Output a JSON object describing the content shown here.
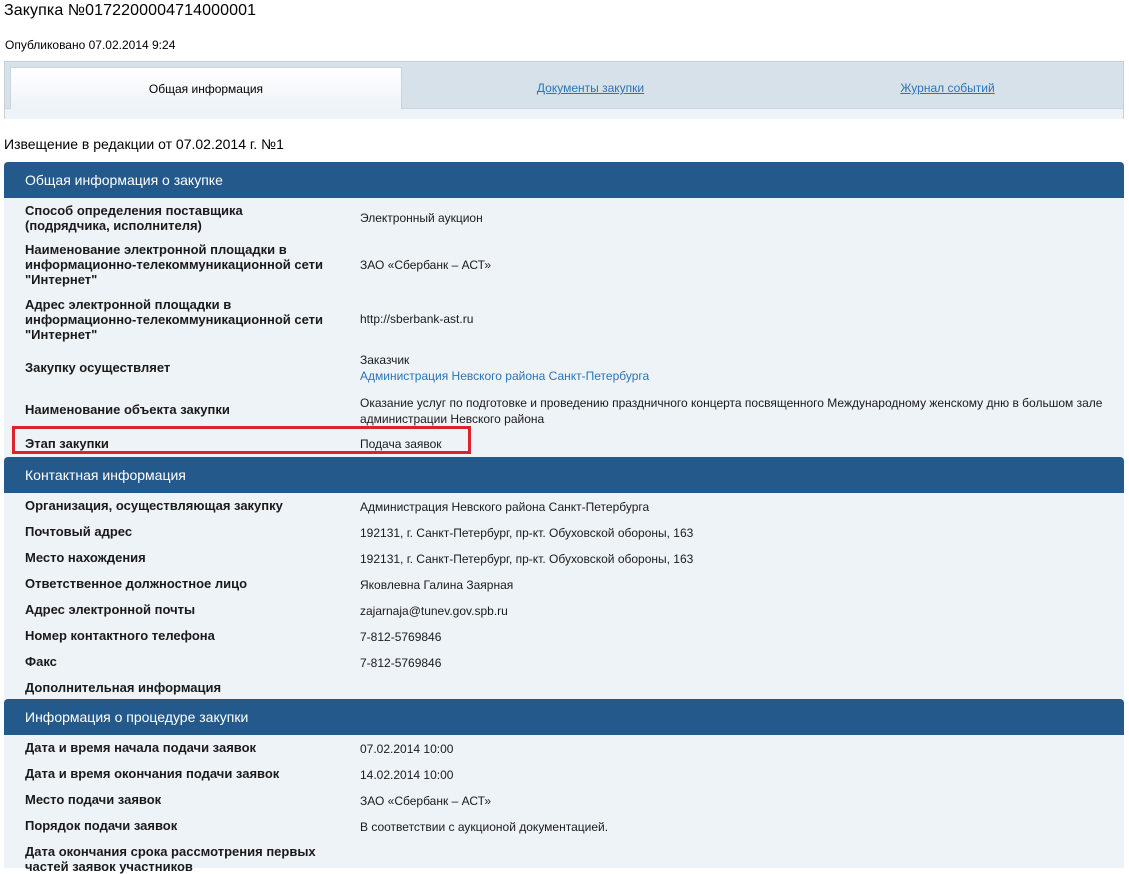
{
  "header": {
    "title": "Закупка №0172200004714000001",
    "published": "Опубликовано 07.02.2014 9:24"
  },
  "tabs": [
    {
      "label": "Общая информация",
      "active": true
    },
    {
      "label": "Документы закупки",
      "active": false
    },
    {
      "label": "Журнал событий",
      "active": false
    }
  ],
  "notice": "Извещение в редакции от 07.02.2014 г. №1",
  "general": {
    "title": "Общая информация о закупке",
    "rows": [
      {
        "label": "Способ определения поставщика (подрядчика, исполнителя)",
        "value": "Электронный аукцион"
      },
      {
        "label": "Наименование электронной площадки в информационно-телекоммуникационной сети \"Интернет\"",
        "value": "ЗАО «Сбербанк – АСТ»"
      },
      {
        "label": "Адрес электронной площадки в информационно-телекоммуникационной сети \"Интернет\"",
        "value": "http://sberbank-ast.ru"
      },
      {
        "label": "Закупку осуществляет",
        "value": "Заказчик",
        "link": "Администрация Невского района Санкт-Петербурга"
      },
      {
        "label": "Наименование объекта закупки",
        "value": "Оказание услуг по подготовке и проведению праздничного концерта посвященного Международному женскому дню в большом зале администрации Невского района"
      },
      {
        "label": "Этап закупки",
        "value": "Подача заявок"
      }
    ]
  },
  "contact": {
    "title": "Контактная информация",
    "rows": [
      {
        "label": "Организация, осуществляющая закупку",
        "value": "Администрация Невского района Санкт-Петербурга"
      },
      {
        "label": "Почтовый адрес",
        "value": "192131, г. Санкт-Петербург, пр-кт. Обуховской обороны, 163"
      },
      {
        "label": "Место нахождения",
        "value": "192131, г. Санкт-Петербург, пр-кт. Обуховской обороны, 163"
      },
      {
        "label": "Ответственное должностное лицо",
        "value": "Яковлевна Галина Заярная"
      },
      {
        "label": "Адрес электронной почты",
        "value": "zajarnaja@tunev.gov.spb.ru"
      },
      {
        "label": "Номер контактного телефона",
        "value": "7-812-5769846"
      },
      {
        "label": "Факс",
        "value": "7-812-5769846"
      },
      {
        "label": "Дополнительная информация",
        "value": ""
      }
    ]
  },
  "procedure": {
    "title": "Информация о процедуре закупки",
    "rows": [
      {
        "label": "Дата и время начала подачи заявок",
        "value": "07.02.2014 10:00"
      },
      {
        "label": "Дата и время окончания подачи заявок",
        "value": "14.02.2014 10:00"
      },
      {
        "label": "Место подачи заявок",
        "value": "ЗАО «Сбербанк – АСТ»"
      },
      {
        "label": "Порядок подачи заявок",
        "value": "В соответствии с аукционой документацией."
      },
      {
        "label": "Дата окончания срока рассмотрения первых частей заявок участников",
        "value": ""
      }
    ]
  },
  "colors": {
    "section_header": "#24598c",
    "link": "#2a74b8",
    "highlight": "#d9232d"
  }
}
